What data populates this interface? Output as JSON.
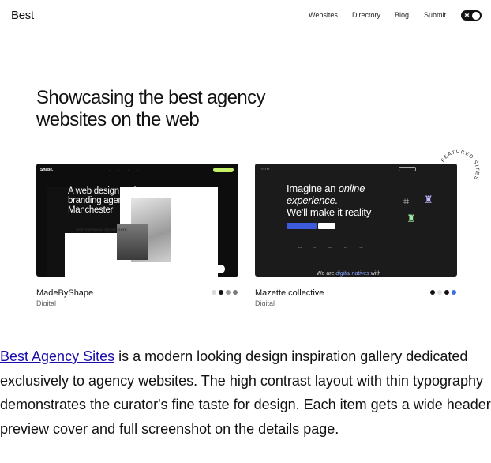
{
  "screenshot": {
    "nav": {
      "logo": "Best",
      "links": [
        "Websites",
        "Directory",
        "Blog",
        "Submit"
      ],
      "theme_toggle": "dark-mode-toggle"
    },
    "headline": "Showcasing the best agency websites on the web",
    "cards": [
      {
        "title": "MadeByShape",
        "subtitle": "Digital",
        "thumb": {
          "brand": "Shape.",
          "tagline": "A web design and branding agency in Manchester",
          "caption": "Marylebone Apartment"
        },
        "dots": [
          "#d9d9d9",
          "#111111",
          "#9a9a9a",
          "#7a7a7a"
        ]
      },
      {
        "title": "Mazette collective",
        "subtitle": "Digital",
        "thumb": {
          "heading_1": "Imagine an ",
          "heading_italic": "online",
          "heading_2": "experience.",
          "heading_3": "We'll make it reality",
          "footer_1": "We are ",
          "footer_italic": "digital natives",
          "footer_2": " with"
        },
        "dots": [
          "#111111",
          "#e2e2e2",
          "#111111",
          "#3b6fe0"
        ]
      }
    ],
    "featured_badge": "FEATURED SITES"
  },
  "description": {
    "link_text": "Best Agency Sites",
    "body": " is a modern looking design inspiration gallery dedicated exclusively to agency websites. The high contrast layout with thin typography demonstrates the curator's fine taste for design. Each item gets a wide header preview cover and full screenshot on the details page."
  }
}
